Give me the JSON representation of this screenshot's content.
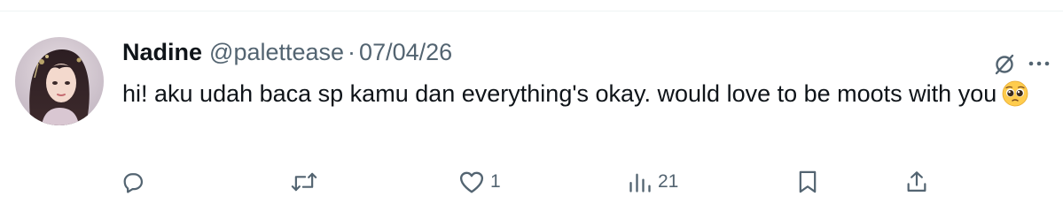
{
  "tweet": {
    "display_name": "Nadine",
    "handle": "@palettease",
    "separator": "·",
    "date": "07/04/26",
    "text": "hi! aku udah baca sp kamu dan everything's okay. would love to be moots with you",
    "emoji": "pleading-face"
  },
  "actions": {
    "reply_icon": "reply-icon",
    "retweet_icon": "retweet-icon",
    "like_icon": "heart-icon",
    "like_count": "1",
    "views_icon": "views-icon",
    "views_count": "21",
    "bookmark_icon": "bookmark-icon",
    "share_icon": "share-icon"
  },
  "header_icons": {
    "grok": "grok-icon",
    "more": "more-icon"
  },
  "colors": {
    "text_primary": "#0f1419",
    "text_secondary": "#536471",
    "divider": "#eff3f4"
  }
}
